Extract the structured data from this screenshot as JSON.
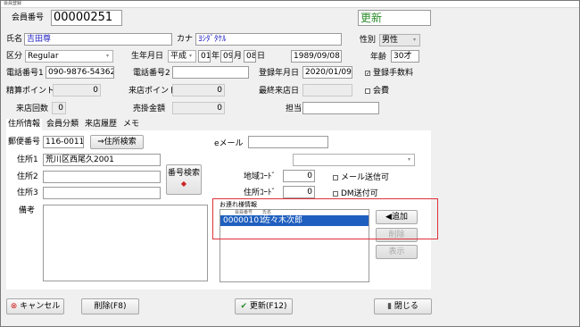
{
  "window": {
    "title": "会員登録"
  },
  "header": {
    "member_no_label": "会員番号",
    "member_no": "00000251",
    "mode": "更新"
  },
  "form": {
    "name_label": "氏名",
    "name": "吉田尊",
    "kana_label": "カナ",
    "kana": "ﾖｼﾀﾞﾀｹﾙ",
    "gender_label": "性別",
    "gender": "男性",
    "category_label": "区分",
    "category": "Regular",
    "birthday_label": "生年月日",
    "era": "平成",
    "birth_y": "01",
    "y_unit": "年",
    "birth_m": "09",
    "m_unit": "月",
    "birth_d": "08",
    "d_unit": "日",
    "birth_western": "1989/09/08",
    "age_label": "年齢",
    "age": "30才",
    "phone1_label": "電話番号1",
    "phone1": "090-9876-54362",
    "phone2_label": "電話番号2",
    "phone2": "",
    "reg_date_label": "登録年月日",
    "reg_date": "2020/01/09",
    "reg_fee_label": "登録手数料",
    "points_label": "精算ポイント",
    "points": "0",
    "visit_points_label": "来店ポイント",
    "visit_points": "0",
    "last_visit_label": "最終来店日",
    "last_visit": "",
    "membership_fee_label": "会費",
    "visits_label": "来店回数",
    "visits": "0",
    "sales_label": "売掛金額",
    "sales": "0",
    "staff_label": "担当",
    "staff": ""
  },
  "tabs": [
    "住所情報",
    "会員分類",
    "来店履歴",
    "メモ"
  ],
  "address": {
    "postal_label": "郵便番号",
    "postal": "116-0011",
    "postal_search": "⇒住所検索",
    "addr1_label": "住所1",
    "addr1": "荒川区西尾久2001",
    "addr2_label": "住所2",
    "addr2": "",
    "addr3_label": "住所3",
    "addr3": "",
    "number_search": "番号検索",
    "notes_label": "備考",
    "email_label": "eメール",
    "email": "",
    "area_code_label": "地域ｺｰﾄﾞ",
    "area_code": "0",
    "addr_code_label": "住所ｺｰﾄﾞ",
    "addr_code": "0",
    "mail_ok_label": "メール送信可",
    "dm_ok_label": "DM送付可",
    "companion_label": "お連れ様情報",
    "companion_col_no": "会員番号",
    "companion_col_name": "氏名",
    "companion_rows": [
      {
        "no": "00000101",
        "name": "佐々木次郎"
      }
    ],
    "add_button": "◀追加",
    "delete_button": "削除",
    "show_button": "表示"
  },
  "footer": {
    "cancel": "キャンセル",
    "delete": "削除(F8)",
    "update": "更新(F12)",
    "close": "閉じる"
  },
  "colors": {
    "accent_green": "#2a8a2a",
    "highlight_red": "#e0303a",
    "selection_blue": "#1f5fbf"
  }
}
